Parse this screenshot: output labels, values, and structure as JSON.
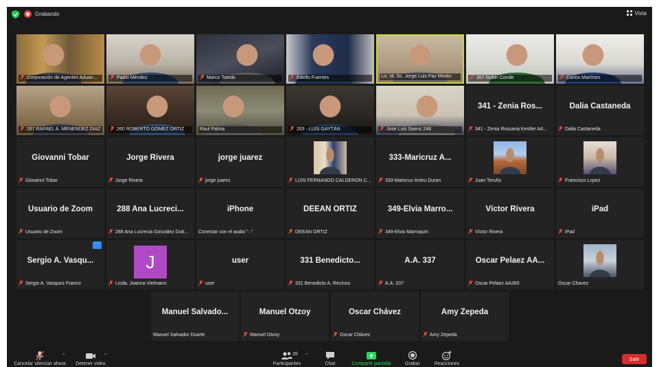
{
  "topbar": {
    "recording_label": "Grabando",
    "view_label": "Vista",
    "icons": [
      "shield-icon",
      "record-icon",
      "grid-view-icon"
    ]
  },
  "tiles": [
    {
      "name": "Corporación de Agentes Aduan...",
      "muted": true,
      "video": true
    },
    {
      "name": "Pablo Méndez",
      "muted": true,
      "video": true
    },
    {
      "name": "Marco Toledo",
      "muted": true,
      "video": true
    },
    {
      "name": "Edelfo Fuentes",
      "muted": true,
      "video": true
    },
    {
      "name": "Lic. M. Sc. Jorge Luis Paz Morán",
      "muted": false,
      "video": true,
      "active": true
    },
    {
      "name": "357 Robin Conde",
      "muted": true,
      "video": true
    },
    {
      "name": "Carlos Martínez",
      "muted": true,
      "video": true
    },
    {
      "name": "267 RAFAEL A. MENENDEZ DIAZ",
      "muted": true,
      "video": true
    },
    {
      "name": "260 ROBERTO GOMEZ ORTIZ",
      "muted": true,
      "video": true
    },
    {
      "name": "Raul Palma",
      "muted": false,
      "video": true
    },
    {
      "name": "263 - LUIS GAYTÁN",
      "muted": true,
      "video": true
    },
    {
      "name": "Jose Luis Saenz 248",
      "muted": true,
      "video": true
    },
    {
      "display": "341 - Zenia Ros...",
      "name": "341 - Zenia Rossana Kestler Ad...",
      "muted": true
    },
    {
      "display": "Dalia Castaneda",
      "name": "Dalia Castaneda",
      "muted": true
    },
    {
      "display": "Giovanni Tobar",
      "name": "Giovanni Tobar",
      "muted": true
    },
    {
      "display": "Jorge Rivera",
      "name": "Jorge Rivera",
      "muted": true
    },
    {
      "display": "jorge juarez",
      "name": "jorge juarez",
      "muted": true
    },
    {
      "name": "LUIS FERNANDO CALDERON C...",
      "muted": true,
      "thumb": "office"
    },
    {
      "display": "333-Maricruz A...",
      "name": "333-Maricruz Anleu Duran",
      "muted": true
    },
    {
      "name": "Juan Toruño",
      "muted": true,
      "thumb": "landscape"
    },
    {
      "name": "Francisco Lopez",
      "muted": true,
      "thumb": "family"
    },
    {
      "display": "Usuario de Zoom",
      "name": "Usuario de Zoom",
      "muted": true
    },
    {
      "display": "288 Ana Lucreci...",
      "name": "288 Ana Lucrecia González Dub...",
      "muted": true
    },
    {
      "display": "iPhone",
      "name": "Conectar con el audio \"··\"",
      "muted": false
    },
    {
      "display": "DEEAN ORTIZ",
      "name": "DEEAN ORTIZ",
      "muted": true
    },
    {
      "display": "349-Elvia Marro...",
      "name": "349-Elvia Marroquín",
      "muted": true
    },
    {
      "display": "Víctor Rivera",
      "name": "Víctor Rivera",
      "muted": true
    },
    {
      "display": "iPad",
      "name": "iPad",
      "muted": true
    },
    {
      "display": "Sergio A. Vasqu...",
      "name": "Sergio A. Vasquez Franco",
      "muted": true,
      "menu": "···"
    },
    {
      "name": "Licda. Joanna Vielmann",
      "muted": true,
      "avatar": "J"
    },
    {
      "display": "user",
      "name": "user",
      "muted": true
    },
    {
      "display": "331 Benedicto...",
      "name": "331 Benedicto A. Recinos",
      "muted": true
    },
    {
      "display": "A.A. 337",
      "name": "A.A. 337",
      "muted": true
    },
    {
      "display": "Oscar Pelaez AA...",
      "name": "Oscar Pelaez AA365",
      "muted": true
    },
    {
      "name": "Oscar Chavez",
      "muted": false,
      "thumb": "portrait"
    },
    {
      "display": "Manuel Salvado...",
      "name": "Manuel Salvador Duarte",
      "muted": false
    },
    {
      "display": "Manuel Otzoy",
      "name": "Manuel Otzoy",
      "muted": true
    },
    {
      "display": "Oscar Chávez",
      "name": "Oscar Chávez",
      "muted": true
    },
    {
      "display": "Amy Zepeda",
      "name": "Amy Zepeda",
      "muted": true
    }
  ],
  "toolbar": {
    "mute_label": "Cancelar silenciar ahora",
    "video_label": "Detener video",
    "participants_label": "Participantes",
    "participants_count": "39",
    "chat_label": "Chat",
    "share_label": "Compartir pantalla",
    "record_label": "Grabar",
    "reactions_label": "Reacciones",
    "leave_label": "Salir"
  },
  "colors": {
    "background": "#1a1a1a",
    "tile": "#232323",
    "active_border": "#c6d93b",
    "share_green": "#23d959",
    "leave_red": "#d62d2d",
    "muted_red": "#e34b43"
  }
}
